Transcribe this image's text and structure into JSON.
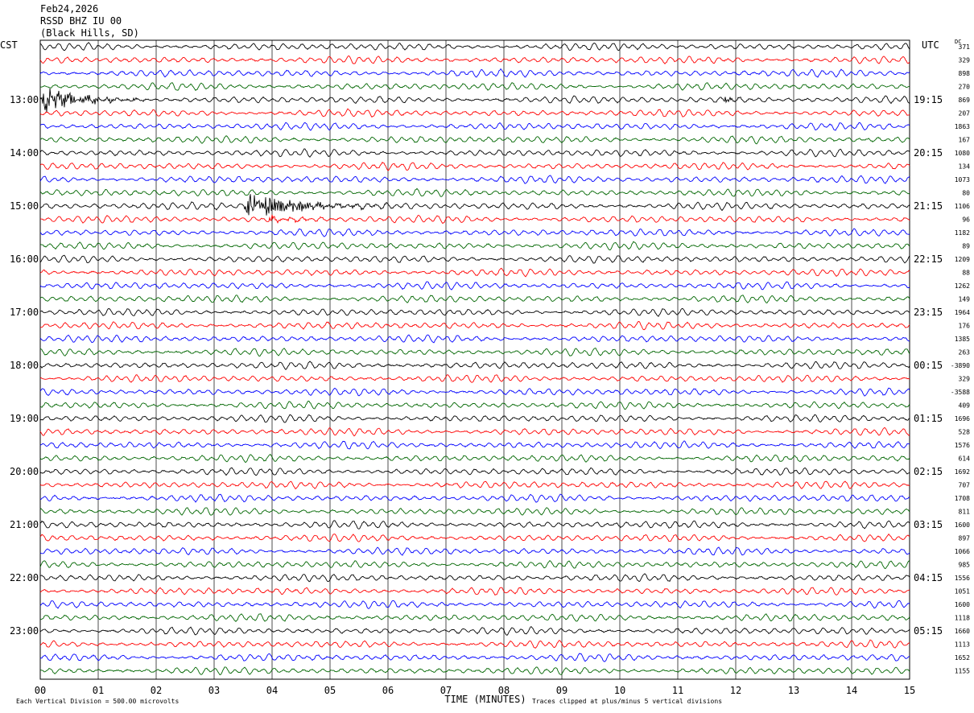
{
  "header": {
    "date": "Feb24,2026",
    "station": "RSSD BHZ IU 00",
    "location": "(Black Hills, SD)"
  },
  "labels": {
    "left_zone": "CST",
    "right_zone": "UTC",
    "dc_header": "DC"
  },
  "footer": {
    "scale_note": "Each Vertical Division =   500.00 microvolts",
    "clip_note": "Traces clipped at plus/minus 5 vertical divisions"
  },
  "colors": {
    "trace_cycle": [
      "#000000",
      "#ff0000",
      "#0000ff",
      "#006600"
    ],
    "grid": "#000000",
    "background": "#ffffff"
  },
  "chart_data": {
    "type": "line",
    "subtype": "helicorder",
    "xlabel": "TIME (MINUTES)",
    "xlim": [
      0,
      15
    ],
    "x_tick_labels": [
      "00",
      "01",
      "02",
      "03",
      "04",
      "05",
      "06",
      "07",
      "08",
      "09",
      "10",
      "11",
      "12",
      "13",
      "14",
      "15"
    ],
    "line_minutes": 15,
    "left_time_labels": [
      "13:00",
      "14:00",
      "15:00",
      "16:00",
      "17:00",
      "18:00",
      "19:00",
      "20:00",
      "21:00",
      "22:00",
      "23:00"
    ],
    "right_time_labels": [
      "19:15",
      "20:15",
      "21:15",
      "22:15",
      "23:15",
      "00:15",
      "01:15",
      "02:15",
      "03:15",
      "04:15",
      "05:15"
    ],
    "dc_offsets": [
      "371",
      "329",
      "898",
      "270",
      "869",
      "207",
      "1863",
      "167",
      "1080",
      "134",
      "1073",
      "80",
      "1106",
      "96",
      "1182",
      "89",
      "1209",
      "88",
      "1262",
      "149",
      "1964",
      "176",
      "1385",
      "263",
      "-3890",
      "329",
      "-3588",
      "409",
      "1696",
      "528",
      "1576",
      "614",
      "1692",
      "707",
      "1708",
      "811",
      "1600",
      "897",
      "1066",
      "985",
      "1556",
      "1051",
      "1600",
      "1118",
      "1660",
      "1113",
      "1652",
      "1155"
    ],
    "events": [
      {
        "line": 4,
        "start_min": 0.0,
        "end_min": 1.8,
        "peak_divisions": 5
      },
      {
        "line": 4,
        "start_min": 11.8,
        "end_min": 12.1,
        "peak_divisions": 2.2
      },
      {
        "line": 12,
        "start_min": 3.5,
        "end_min": 6.0,
        "peak_divisions": 5
      },
      {
        "line": 13,
        "start_min": 3.9,
        "end_min": 5.2,
        "peak_divisions": 1.3
      }
    ]
  }
}
